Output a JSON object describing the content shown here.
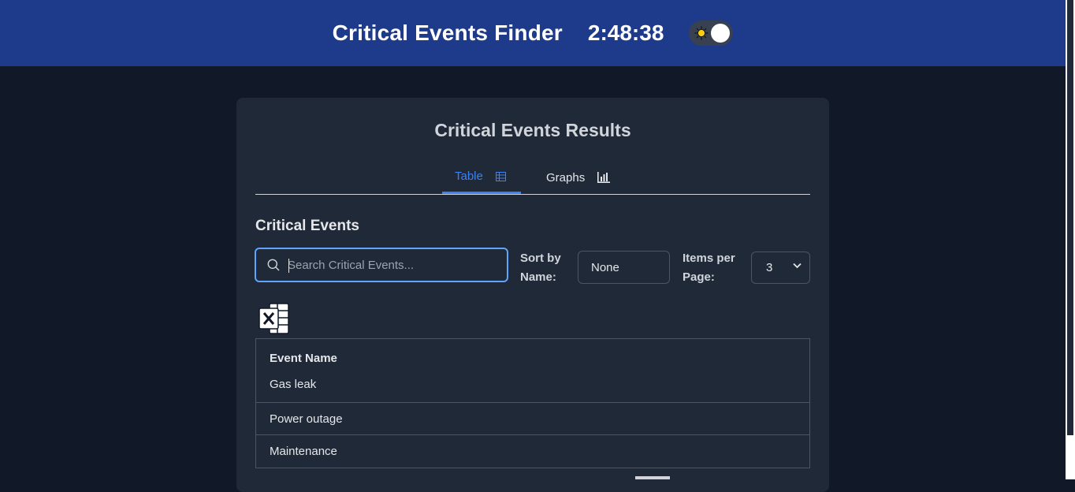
{
  "header": {
    "app_title": "Critical Events Finder",
    "clock": "2:48:38",
    "theme_toggle": "light-mode"
  },
  "card": {
    "title": "Critical Events Results",
    "tabs": [
      {
        "label": "Table",
        "icon": "table-icon",
        "active": true
      },
      {
        "label": "Graphs",
        "icon": "bar-chart-icon",
        "active": false
      }
    ]
  },
  "section": {
    "title": "Critical Events"
  },
  "controls": {
    "search_placeholder": "Search Critical Events...",
    "search_value": "",
    "sort_label": "Sort by Name:",
    "sort_value": "None",
    "items_per_page_label": "Items per Page:",
    "items_per_page_value": "3",
    "export_icon": "excel-export-icon"
  },
  "table": {
    "columns": [
      "Event Name"
    ],
    "rows": [
      "Gas leak",
      "Power outage",
      "Maintenance"
    ]
  },
  "colors": {
    "header_bg": "#1e3a8a",
    "page_bg": "#111827",
    "card_bg": "#1f2937",
    "accent": "#3b82f6"
  }
}
